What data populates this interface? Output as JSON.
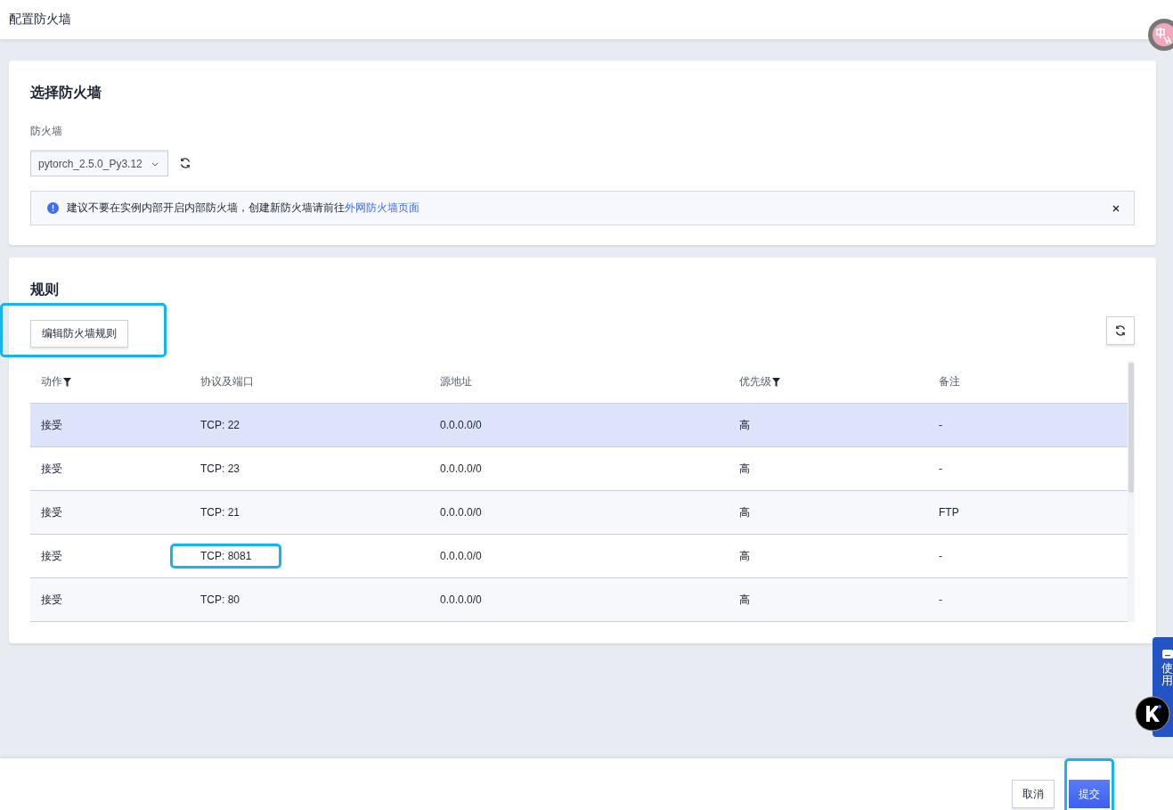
{
  "header": {
    "title": "配置防火墙"
  },
  "select_section": {
    "title": "选择防火墙",
    "field_label": "防火墙",
    "firewall": {
      "value": "pytorch_2.5.0_Py3.12"
    },
    "notice": {
      "text": "建议不要在实例内部开启内部防火墙，创建新防火墙请前往",
      "link": "外网防火墙页面"
    }
  },
  "rules_section": {
    "title": "规则",
    "edit_button": {
      "label": "编辑防火墙规则",
      "highlighted": true
    },
    "table": {
      "columns": [
        {
          "label": "动作",
          "filter": true
        },
        {
          "label": "协议及端口",
          "filter": false
        },
        {
          "label": "源地址",
          "filter": false
        },
        {
          "label": "优先级",
          "filter": true
        },
        {
          "label": "备注",
          "filter": false
        }
      ],
      "rows": [
        {
          "selected": true,
          "cells": [
            {
              "text": "接受",
              "highlighted": false
            },
            {
              "text": "TCP: 22",
              "highlighted": false
            },
            {
              "text": "0.0.0.0/0",
              "highlighted": false
            },
            {
              "text": "高",
              "highlighted": false
            },
            {
              "text": "-",
              "highlighted": false
            }
          ]
        },
        {
          "selected": false,
          "cells": [
            {
              "text": "接受",
              "highlighted": false
            },
            {
              "text": "TCP: 23",
              "highlighted": false
            },
            {
              "text": "0.0.0.0/0",
              "highlighted": false
            },
            {
              "text": "高",
              "highlighted": false
            },
            {
              "text": "-",
              "highlighted": false
            }
          ]
        },
        {
          "selected": false,
          "cells": [
            {
              "text": "接受",
              "highlighted": false
            },
            {
              "text": "TCP: 21",
              "highlighted": false
            },
            {
              "text": "0.0.0.0/0",
              "highlighted": false
            },
            {
              "text": "高",
              "highlighted": false
            },
            {
              "text": "FTP",
              "highlighted": false
            }
          ]
        },
        {
          "selected": false,
          "cells": [
            {
              "text": "接受",
              "highlighted": false
            },
            {
              "text": "TCP: 8081",
              "highlighted": true
            },
            {
              "text": "0.0.0.0/0",
              "highlighted": false
            },
            {
              "text": "高",
              "highlighted": false
            },
            {
              "text": "-",
              "highlighted": false
            }
          ]
        },
        {
          "selected": false,
          "cells": [
            {
              "text": "接受",
              "highlighted": false
            },
            {
              "text": "TCP: 80",
              "highlighted": false
            },
            {
              "text": "0.0.0.0/0",
              "highlighted": false
            },
            {
              "text": "高",
              "highlighted": false
            },
            {
              "text": "-",
              "highlighted": false
            }
          ]
        }
      ]
    }
  },
  "side_tab": {
    "text": "使用"
  },
  "footer": {
    "buttons": [
      {
        "label": "取消",
        "kind": "secondary",
        "highlighted": false
      },
      {
        "label": "提交",
        "kind": "primary",
        "highlighted": true
      }
    ]
  }
}
